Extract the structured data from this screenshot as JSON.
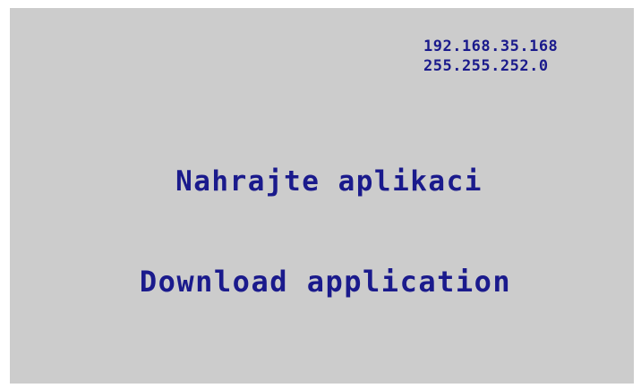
{
  "network": {
    "ip_address": "192.168.35.168",
    "subnet_mask": "255.255.252.0"
  },
  "messages": {
    "czech": "Nahrajte aplikaci",
    "english": "Download application"
  },
  "colors": {
    "background": "#cccccc",
    "text": "#1a1a8c"
  }
}
